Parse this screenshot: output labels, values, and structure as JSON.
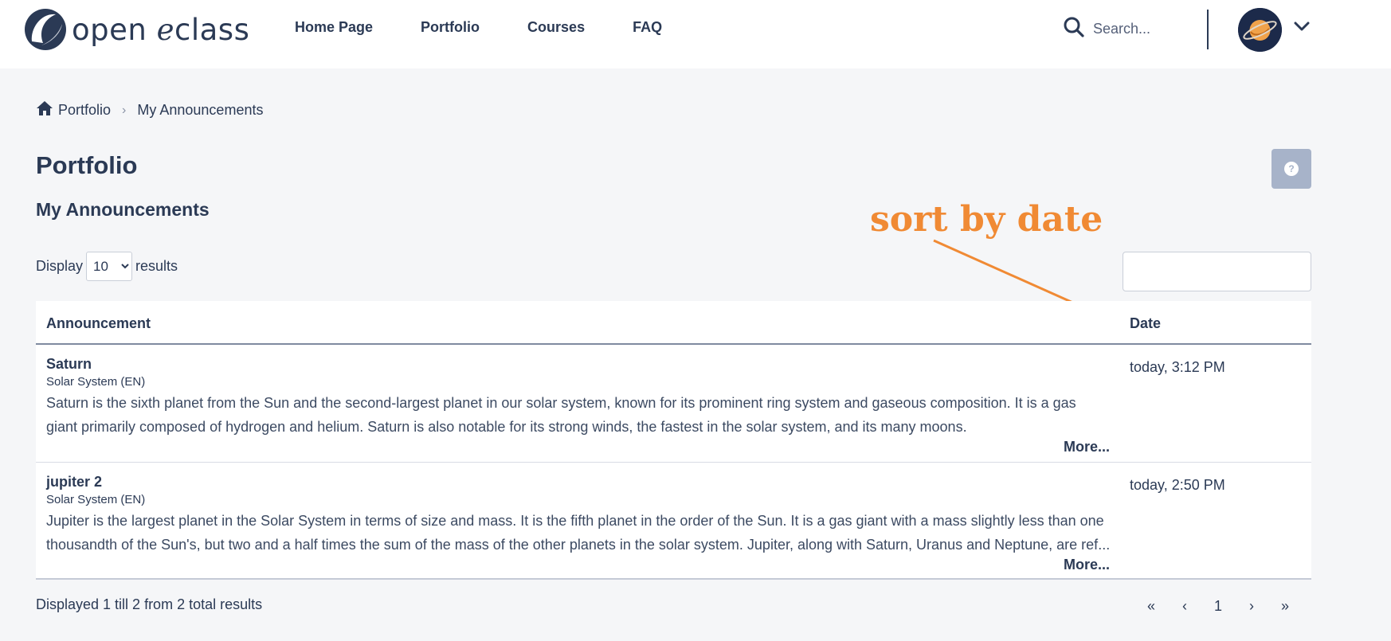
{
  "brand": {
    "part1": "open ",
    "part2": "e",
    "part3": "class"
  },
  "nav": {
    "home": "Home Page",
    "portfolio": "Portfolio",
    "courses": "Courses",
    "faq": "FAQ"
  },
  "search": {
    "placeholder": "Search..."
  },
  "breadcrumb": {
    "home": "Portfolio",
    "current": "My Announcements"
  },
  "page_title": "Portfolio",
  "section_title": "My Announcements",
  "annotation": "sort by date",
  "display": {
    "prefix": "Display",
    "value": "10",
    "suffix": "results"
  },
  "table": {
    "headers": {
      "announcement": "Announcement",
      "date": "Date"
    },
    "rows": [
      {
        "title": "Saturn",
        "course": "Solar System (EN)",
        "line1": "Saturn is the sixth planet from the Sun and the second-largest planet in our solar system, known for its prominent ring system and gaseous composition. It is a gas",
        "line2": "giant primarily composed of hydrogen and helium. Saturn is also notable for its strong winds, the fastest in the solar system, and its many moons.",
        "more": "More...",
        "date": "today, 3:12 PM"
      },
      {
        "title": "jupiter 2",
        "course": "Solar System (EN)",
        "line1": "Jupiter is the largest planet in the Solar System in terms of size and mass. It is the fifth planet in the order of the Sun. It is a gas giant with a mass slightly less than one",
        "line2": "thousandth of the Sun's, but two and a half times the sum of the mass of the other planets in the solar system. Jupiter, along with Saturn, Uranus and Neptune, are ref...",
        "more": "More...",
        "date": "today, 2:50 PM"
      }
    ]
  },
  "footer_info": "Displayed 1 till 2 from 2 total results",
  "pager": {
    "first": "«",
    "prev": "‹",
    "page": "1",
    "next": "›",
    "last": "»"
  },
  "colors": {
    "accent": "#f08a34",
    "text": "#2b3a55",
    "help_button": "#a7b3c9"
  },
  "icons": {
    "search": "search-icon",
    "home": "home-icon",
    "chevron": "chevron-down-icon",
    "help": "help-icon"
  }
}
